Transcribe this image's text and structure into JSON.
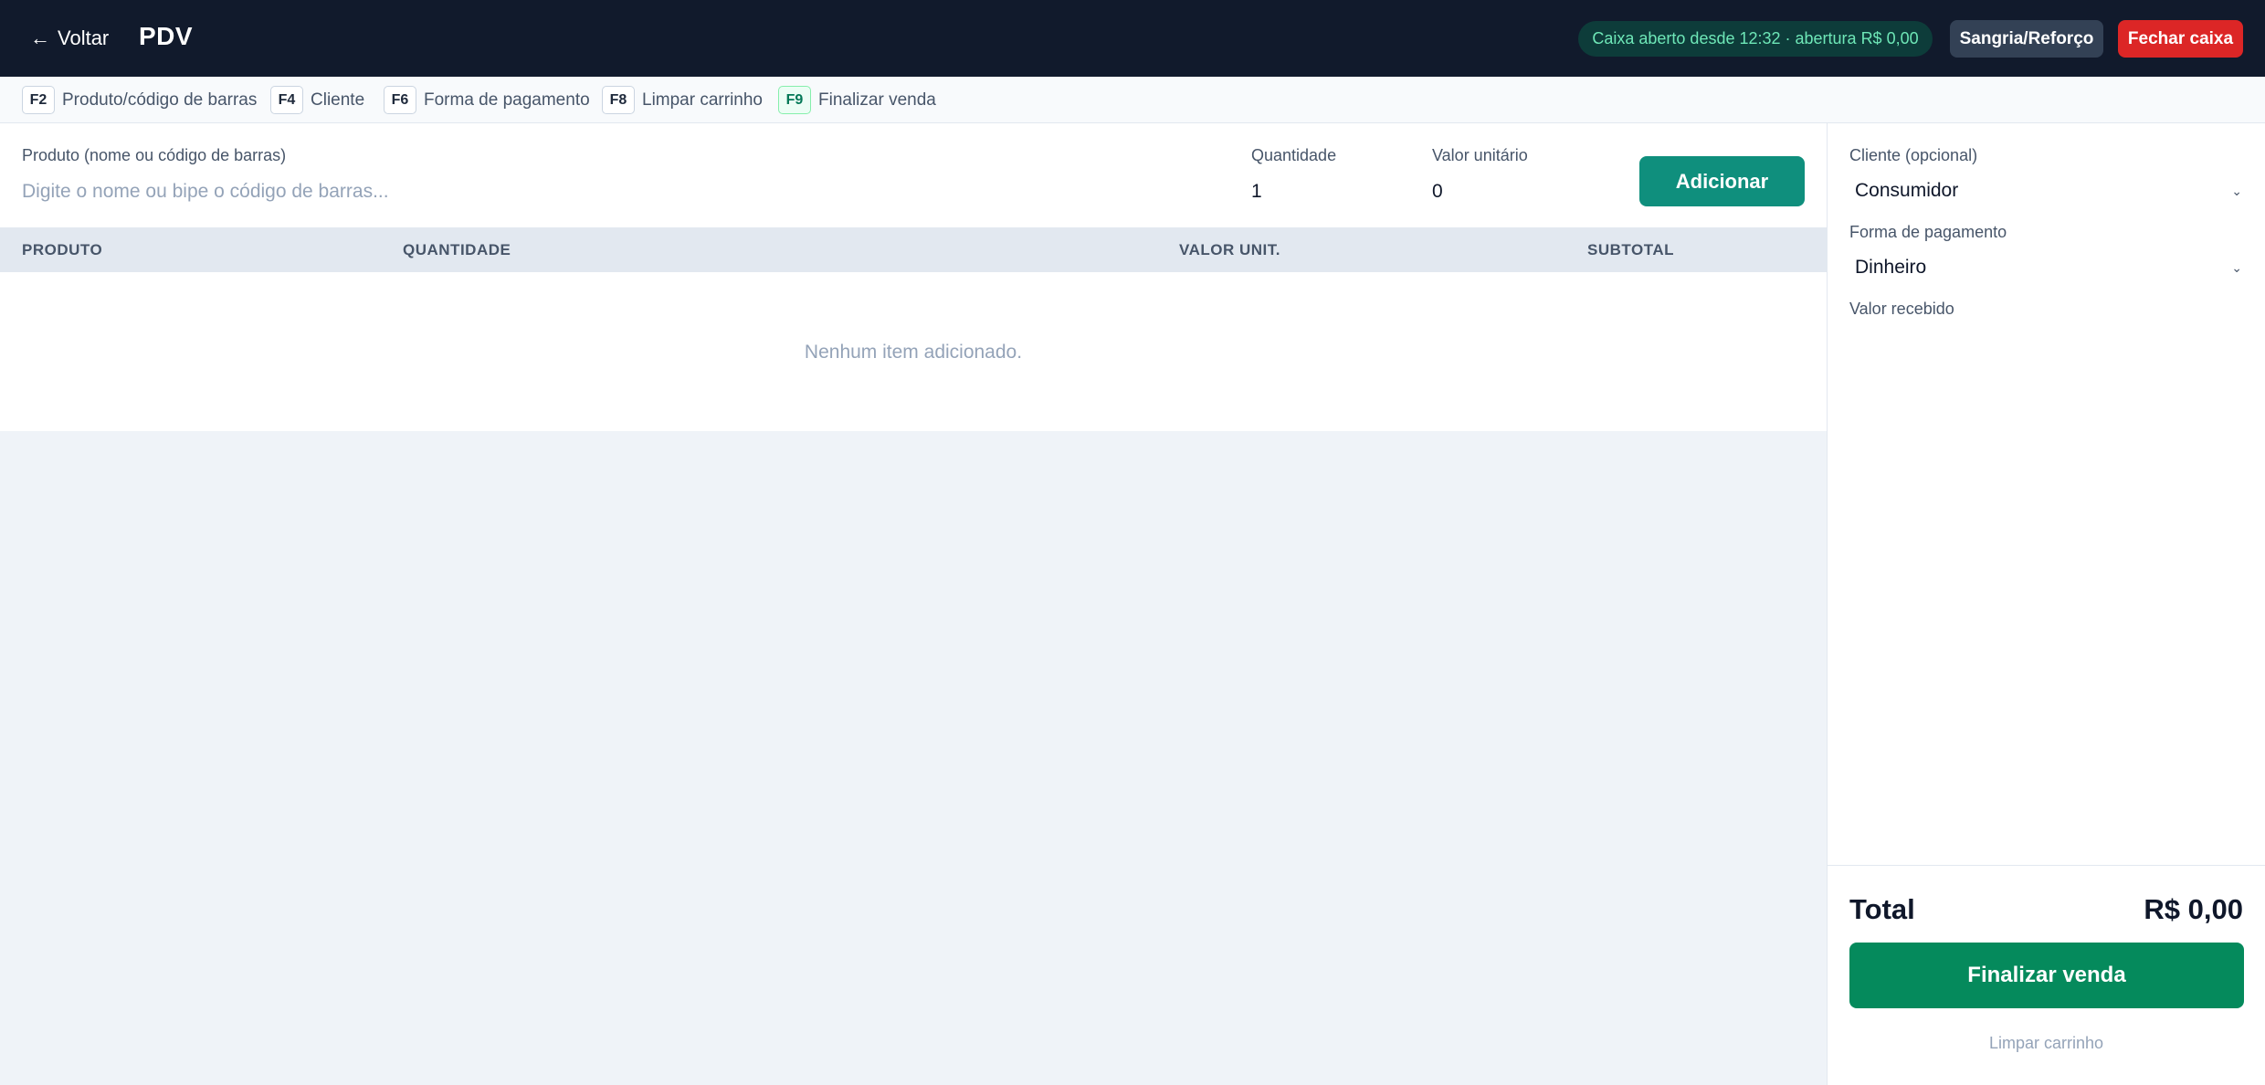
{
  "header": {
    "back_arrow": "←",
    "back_label": "Voltar",
    "title": "PDV",
    "status": "Caixa aberto desde 12:32 · abertura R$ 0,00",
    "sangria_label": "Sangria/Reforço",
    "fechar_label": "Fechar caixa"
  },
  "shortcuts": [
    {
      "key": "F2",
      "label": "Produto/código de barras"
    },
    {
      "key": "F4",
      "label": "Cliente"
    },
    {
      "key": "F6",
      "label": "Forma de pagamento"
    },
    {
      "key": "F8",
      "label": "Limpar carrinho"
    },
    {
      "key": "F9",
      "label": "Finalizar venda"
    }
  ],
  "entry": {
    "product_label": "Produto (nome ou código de barras)",
    "product_placeholder": "Digite o nome ou bipe o código de barras...",
    "qty_label": "Quantidade",
    "qty_value": "1",
    "unit_label": "Valor unitário",
    "unit_value": "0",
    "add_label": "Adicionar"
  },
  "table": {
    "columns": [
      "PRODUTO",
      "QUANTIDADE",
      "VALOR UNIT.",
      "SUBTOTAL"
    ],
    "empty_text": "Nenhum item adicionado."
  },
  "side": {
    "client_label": "Cliente (opcional)",
    "client_value": "Consumidor",
    "payment_label": "Forma de pagamento",
    "payment_value": "Dinheiro",
    "received_label": "Valor recebido",
    "chevron": "⌄",
    "total_label": "Total",
    "total_value": "R$ 0,00",
    "finalize_label": "Finalizar venda",
    "clear_label": "Limpar carrinho"
  },
  "colors": {
    "header_bg": "#111a2c",
    "accent_teal": "#0f8f7d",
    "finalize_green": "#058a5c",
    "danger": "#dc2626",
    "status_text": "#6ee7b7"
  }
}
